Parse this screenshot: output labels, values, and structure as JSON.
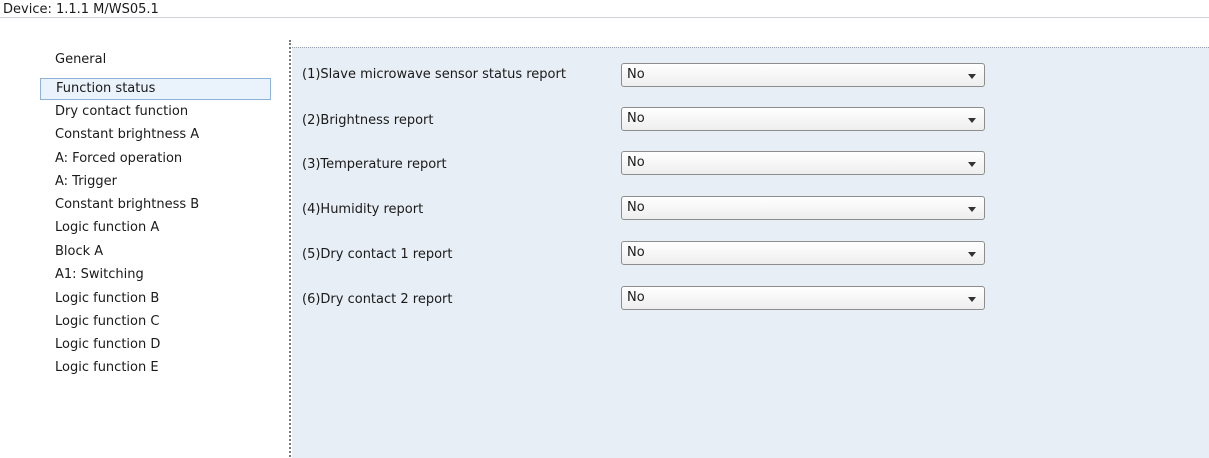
{
  "window": {
    "title": "Device: 1.1.1  M/WS05.1"
  },
  "sidebar": {
    "items": [
      {
        "label": "General",
        "selected": false
      },
      {
        "label": "Function status",
        "selected": true
      },
      {
        "label": "Dry contact function",
        "selected": false
      },
      {
        "label": "Constant brightness A",
        "selected": false
      },
      {
        "label": "A: Forced operation",
        "selected": false
      },
      {
        "label": "A: Trigger",
        "selected": false
      },
      {
        "label": "Constant brightness B",
        "selected": false
      },
      {
        "label": "Logic function A",
        "selected": false
      },
      {
        "label": "Block A",
        "selected": false
      },
      {
        "label": "A1: Switching",
        "selected": false
      },
      {
        "label": "Logic function B",
        "selected": false
      },
      {
        "label": "Logic function C",
        "selected": false
      },
      {
        "label": "Logic function D",
        "selected": false
      },
      {
        "label": "Logic function E",
        "selected": false
      }
    ]
  },
  "main": {
    "rows": [
      {
        "label": "(1)Slave microwave sensor status report",
        "value": "No"
      },
      {
        "label": "(2)Brightness report",
        "value": "No"
      },
      {
        "label": "(3)Temperature report",
        "value": "No"
      },
      {
        "label": "(4)Humidity report",
        "value": "No"
      },
      {
        "label": "(5)Dry contact 1 report",
        "value": "No"
      },
      {
        "label": "(6)Dry contact 2 report",
        "value": "No"
      }
    ]
  },
  "colors": {
    "panel_background": "#e7eef5",
    "selected_item_background": "#eaf2fb",
    "selected_item_border": "#8fb2d9"
  }
}
